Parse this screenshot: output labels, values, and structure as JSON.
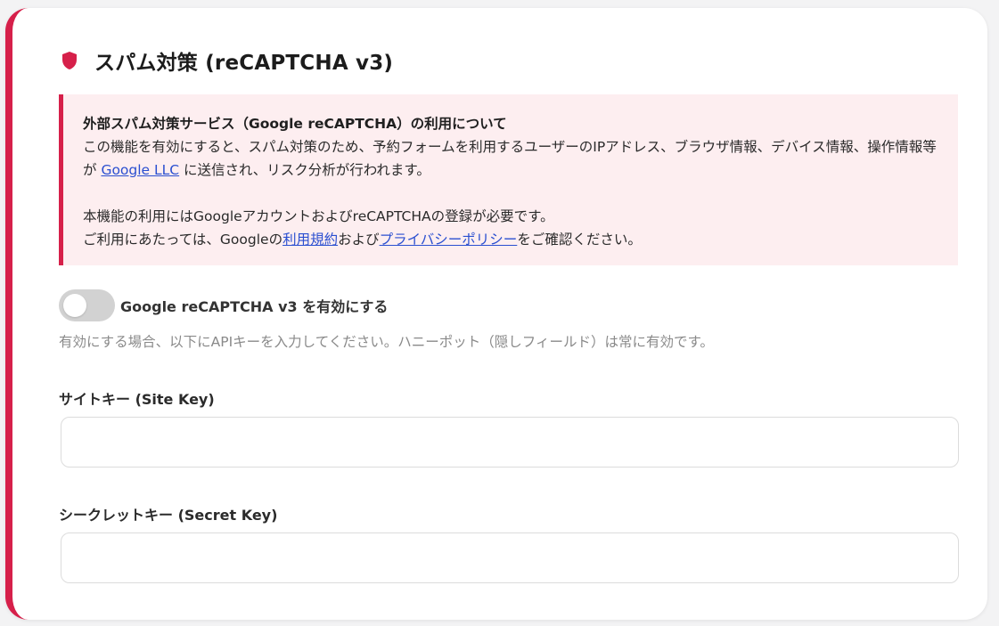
{
  "section": {
    "icon": "shield-icon",
    "title": "スパム対策 (reCAPTCHA v3)",
    "accent_color": "#d6204a"
  },
  "notice": {
    "title": "外部スパム対策サービス（Google reCAPTCHA）の利用について",
    "line1_pre": "この機能を有効にすると、スパム対策のため、予約フォームを利用するユーザーのIPアドレス、ブラウザ情報、デバイス情報、操作情報等が ",
    "google_link": "Google LLC",
    "line1_post": " に送信され、リスク分析が行われます。",
    "line2": "本機能の利用にはGoogleアカウントおよびreCAPTCHAの登録が必要です。",
    "line3_pre": "ご利用にあたっては、Googleの",
    "terms_link": "利用規約",
    "line3_mid": "および",
    "privacy_link": "プライバシーポリシー",
    "line3_post": "をご確認ください。"
  },
  "toggle": {
    "label": "Google reCAPTCHA v3 を有効にする",
    "enabled": false
  },
  "hint": "有効にする場合、以下にAPIキーを入力してください。ハニーポット（隠しフィールド）は常に有効です。",
  "fields": {
    "site_key": {
      "label": "サイトキー (Site Key)",
      "value": ""
    },
    "secret_key": {
      "label": "シークレットキー (Secret Key)",
      "value": ""
    }
  }
}
